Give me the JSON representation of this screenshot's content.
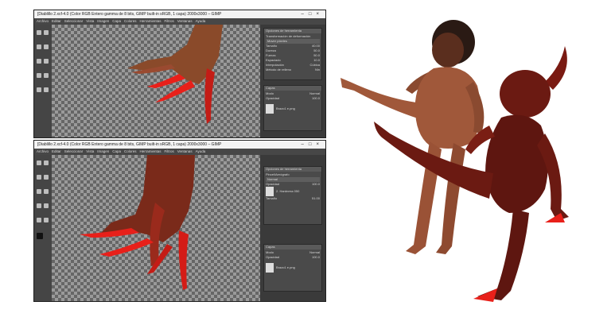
{
  "windows": [
    {
      "title": "[Diablillo 2.xcf-4.0 (Color RGB Entero gamma de 8 bits, GIMP built-in sRGB, 1 capa) 2000x3000 – GIMP",
      "menus": [
        "Archivo",
        "Editar",
        "Seleccionar",
        "Vista",
        "Imagen",
        "Capa",
        "Colores",
        "Herramientas",
        "Filtros",
        "Ventanas",
        "Ayuda"
      ],
      "tool_options": {
        "title": "Opciones de herramienta",
        "heading": "Transformación de deformación",
        "mode": "Mover píxeles",
        "rows": [
          {
            "label": "Tamaño",
            "value": "40.00"
          },
          {
            "label": "Dureza",
            "value": "50.0"
          },
          {
            "label": "Fuerza",
            "value": "50.0"
          },
          {
            "label": "Espaciado",
            "value": "10.0"
          },
          {
            "label": "Interpolación",
            "value": "Cúbica"
          },
          {
            "label": "Método de relleno",
            "value": "Nin"
          }
        ]
      },
      "layers": {
        "title": "Capas",
        "mode": "Normal",
        "opacity": "100.0",
        "layer_name": "Brazo1 e.png"
      }
    },
    {
      "title": "[Diablillo 2.xcf-4.0 (Color RGB Entero gamma de 8 bits, GIMP built-in sRGB, 1 capa) 2000x3000 – GIMP",
      "menus": [
        "Archivo",
        "Editar",
        "Seleccionar",
        "Vista",
        "Imagen",
        "Capa",
        "Colores",
        "Herramientas",
        "Filtros",
        "Ventanas",
        "Ayuda"
      ],
      "tool_options": {
        "title": "Opciones de herramienta",
        "heading": "Pincel/Aerógrafo",
        "mode": "Normal",
        "rows": [
          {
            "label": "Opacidad",
            "value": "100.0"
          },
          {
            "label": "Pincel",
            "value": "2. Hardness 050"
          },
          {
            "label": "Tamaño",
            "value": "51.00"
          }
        ]
      },
      "layers": {
        "title": "Capas",
        "mode": "Normal",
        "opacity": "100.0",
        "layer_name": "Brazo1 e.png"
      }
    }
  ],
  "colors": {
    "skin": "#8a4a2a",
    "red_tip": "#e8201a",
    "demon": "#6b1a12"
  }
}
